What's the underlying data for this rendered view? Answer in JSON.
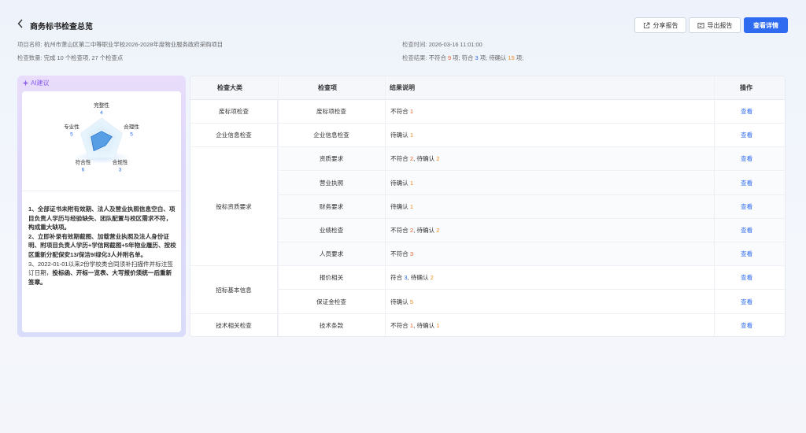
{
  "header": {
    "back_icon": "chevron-left-icon",
    "title": "商务标书检查总览",
    "share_label": "分享报告",
    "export_label": "导出报告",
    "detail_label": "查看详情"
  },
  "meta": {
    "project_label": "项目名称:",
    "project_name": "杭州市萧山区第二中等职业学校2026-2028年度物业服务政府采购项目",
    "time_label": "检查时间:",
    "time_value": "2026-03-16 11:01:00",
    "count_label": "检查数量:",
    "count_value": "完成 10 个检查项, 27 个检查点",
    "result_label": "检查结果:",
    "result_fail_text": "不符合",
    "result_fail_num": "9",
    "result_fail_unit": "项;",
    "result_pass_text": "符合",
    "result_pass_num": "3",
    "result_pass_unit": "项;",
    "result_pending_text": "待确认",
    "result_pending_num": "15",
    "result_pending_unit": "项;"
  },
  "ai": {
    "title": "AI建议",
    "radar": [
      {
        "name": "完整性",
        "score": "4"
      },
      {
        "name": "合理性",
        "score": "5"
      },
      {
        "name": "合规性",
        "score": "3"
      },
      {
        "name": "符合性",
        "score": "6"
      },
      {
        "name": "专业性",
        "score": "5"
      }
    ],
    "p1": "1、全部证书未附有效期、法人及营业执照信息空白、项目负责人学历与经验缺失、团队配置与校区需求不符，构成重大缺项。",
    "p2": "2、立即补录有效期截图、加载营业执照及法人身份证明、附项目负责人学历+学信网截图+5年物业履历、按校区重新分配保安13/保洁9/绿化3人并附名单。",
    "p3a": "3、2022-01-01以来2份学校类合同须补扫描件并标注签订日期，",
    "p3b": "投标函、开标一览表、大写报价须统一后重新签章。"
  },
  "table": {
    "headers": [
      "检查大类",
      "检查项",
      "结果说明",
      "操作"
    ],
    "action_label": "查看",
    "categories": [
      "废标项检查",
      "企业信息检查",
      "投标资质要求",
      "招标基本信息",
      "技术相关检查"
    ],
    "rows": [
      {
        "item": "废标项检查",
        "parts": [
          {
            "t": "不符合 "
          },
          {
            "n": "1",
            "c": "red"
          }
        ]
      },
      {
        "item": "企业信息检查",
        "parts": [
          {
            "t": "待确认 "
          },
          {
            "n": "1",
            "c": "orange"
          }
        ]
      },
      {
        "item": "资质要求",
        "parts": [
          {
            "t": "不符合 "
          },
          {
            "n": "2",
            "c": "red"
          },
          {
            "t": ", 待确认 "
          },
          {
            "n": "2",
            "c": "orange"
          }
        ]
      },
      {
        "item": "营业执照",
        "parts": [
          {
            "t": "待确认 "
          },
          {
            "n": "1",
            "c": "orange"
          }
        ]
      },
      {
        "item": "财务要求",
        "parts": [
          {
            "t": "待确认 "
          },
          {
            "n": "1",
            "c": "orange"
          }
        ]
      },
      {
        "item": "业绩检查",
        "parts": [
          {
            "t": "不符合 "
          },
          {
            "n": "2",
            "c": "red"
          },
          {
            "t": ", 待确认 "
          },
          {
            "n": "2",
            "c": "orange"
          }
        ]
      },
      {
        "item": "人员要求",
        "parts": [
          {
            "t": "不符合 "
          },
          {
            "n": "3",
            "c": "red"
          }
        ]
      },
      {
        "item": "报价相关",
        "parts": [
          {
            "t": "符合 "
          },
          {
            "n": "3",
            "c": "blue"
          },
          {
            "t": ", 待确认 "
          },
          {
            "n": "2",
            "c": "orange"
          }
        ]
      },
      {
        "item": "保证金检查",
        "parts": [
          {
            "t": "待确认 "
          },
          {
            "n": "5",
            "c": "orange"
          }
        ]
      },
      {
        "item": "技术条款",
        "parts": [
          {
            "t": "不符合 "
          },
          {
            "n": "1",
            "c": "red"
          },
          {
            "t": ", 待确认 "
          },
          {
            "n": "1",
            "c": "orange"
          }
        ]
      }
    ]
  },
  "colors": {
    "primary": "#2e6bf0",
    "fail": "#e5602b",
    "pending": "#ee8a1c",
    "ai_accent": "#8a5cf0"
  }
}
